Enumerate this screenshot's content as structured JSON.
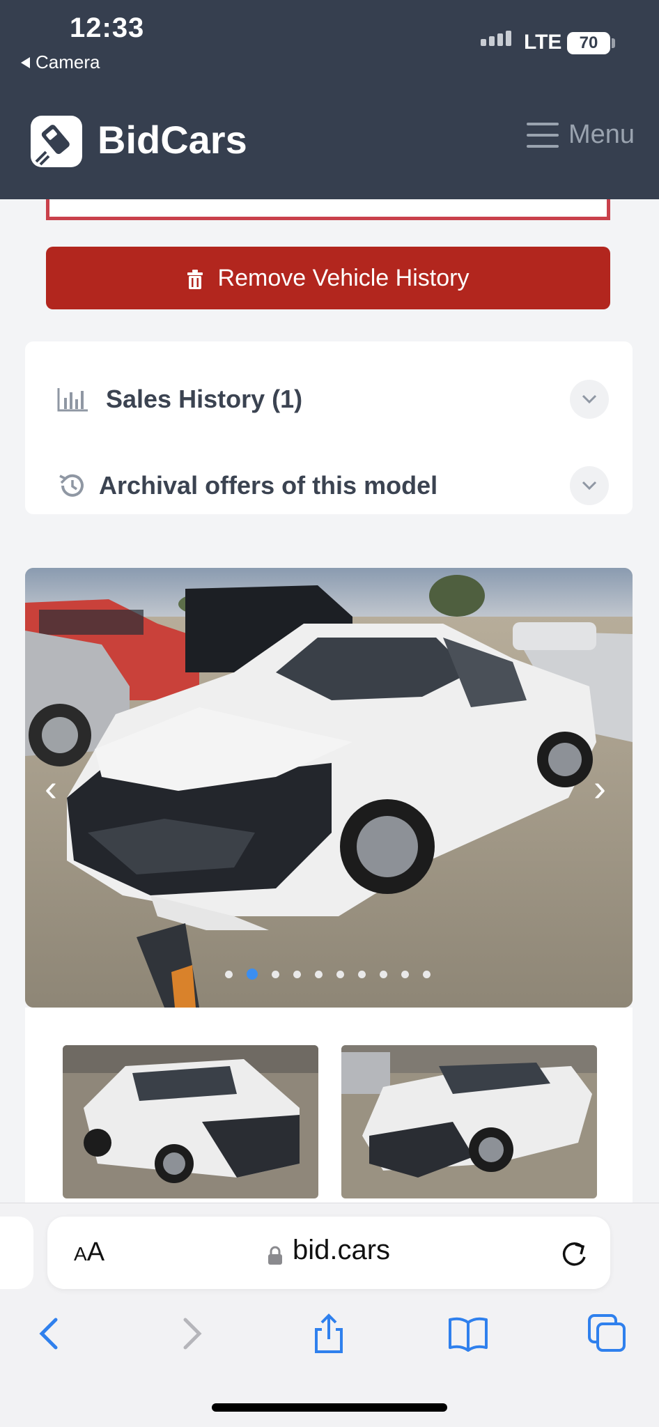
{
  "status_bar": {
    "time": "12:33",
    "back_app": "Camera",
    "network": "LTE",
    "battery": "70"
  },
  "header": {
    "brand": "BidCars",
    "menu_label": "Menu"
  },
  "actions": {
    "remove_history_label": "Remove Vehicle History"
  },
  "accordion": [
    {
      "title": "Sales History (1)",
      "icon": "bar-chart-icon"
    },
    {
      "title": "Archival offers of this model",
      "icon": "history-icon"
    }
  ],
  "gallery": {
    "total_images": 10,
    "active_index": 1,
    "vehicle_description": "damaged white sedan"
  },
  "browser": {
    "text_size_label": "AA",
    "url": "bid.cars"
  },
  "colors": {
    "header_bg": "#363f4f",
    "danger": "#b2261e",
    "accent": "#3b8ef0"
  }
}
